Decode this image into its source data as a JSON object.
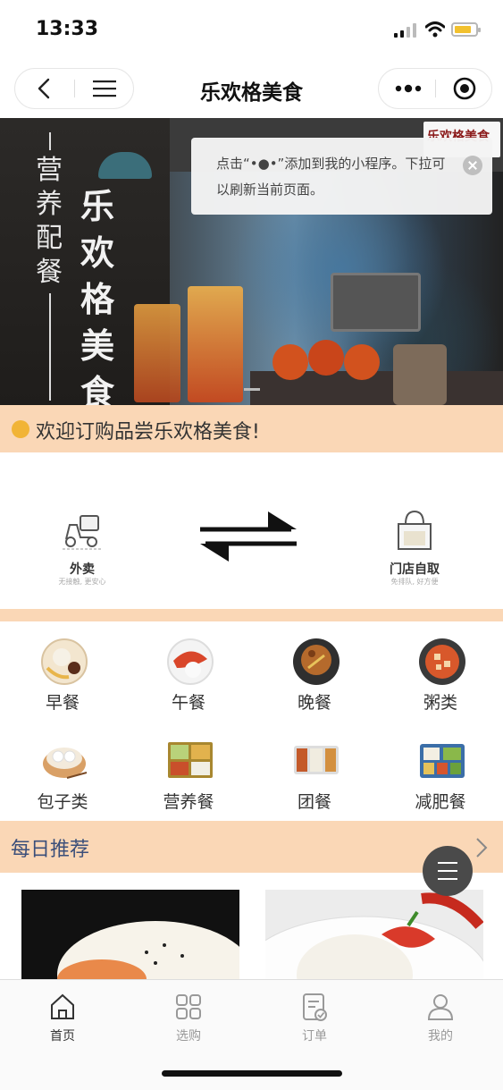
{
  "status_bar": {
    "time": "13:33"
  },
  "nav": {
    "title": "乐欢格美食"
  },
  "banner": {
    "subtitle": "营养配餐",
    "main_title": "乐欢格美食",
    "logo_text": "乐欢格美食"
  },
  "tooltip": {
    "text": "点击“•●•”添加到我的小程序。下拉可以刷新当前页面。"
  },
  "welcome": {
    "text": "欢迎订购品尝乐欢格美食!"
  },
  "delivery": {
    "takeout": {
      "label": "外卖",
      "sub": "无接触, 更安心"
    },
    "pickup": {
      "label": "门店自取",
      "sub": "免排队, 好方便"
    }
  },
  "categories": [
    {
      "label": "早餐",
      "icon": "breakfast-plate-icon"
    },
    {
      "label": "午餐",
      "icon": "lunch-bowl-icon"
    },
    {
      "label": "晚餐",
      "icon": "dinner-plate-icon"
    },
    {
      "label": "粥类",
      "icon": "porridge-pot-icon"
    },
    {
      "label": "包子类",
      "icon": "steamed-bun-icon"
    },
    {
      "label": "营养餐",
      "icon": "bento-icon"
    },
    {
      "label": "团餐",
      "icon": "group-meal-tray-icon"
    },
    {
      "label": "减肥餐",
      "icon": "diet-tray-icon"
    }
  ],
  "daily": {
    "title": "每日推荐"
  },
  "tabs": [
    {
      "label": "首页",
      "icon": "home-icon",
      "active": true
    },
    {
      "label": "选购",
      "icon": "grid-icon",
      "active": false
    },
    {
      "label": "订单",
      "icon": "order-icon",
      "active": false
    },
    {
      "label": "我的",
      "icon": "user-icon",
      "active": false
    }
  ],
  "colors": {
    "peach": "#fad7b6",
    "active_tab": "#333333",
    "inactive_tab": "#999999",
    "daily_title": "#3b4f7a"
  }
}
